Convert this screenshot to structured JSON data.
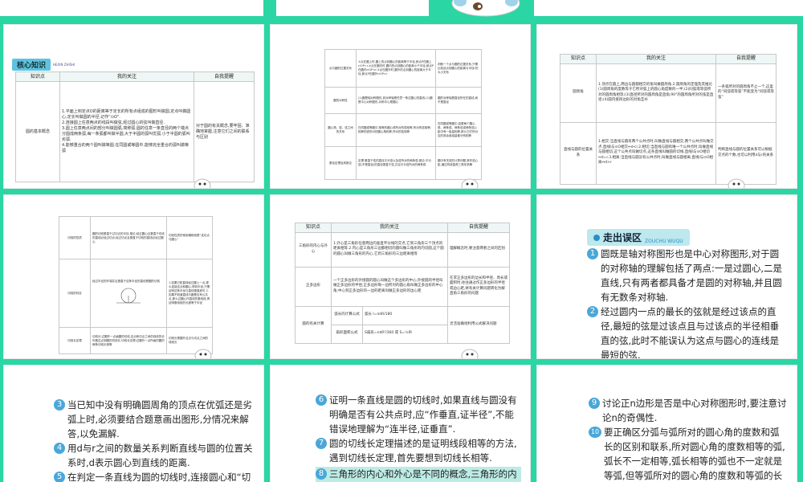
{
  "slide1": {
    "banner_title": "核心知识",
    "banner_sub": "HEXIN ZHISHI",
    "headers": [
      "知识点",
      "我的关注",
      "自我提醒"
    ],
    "row_point": "圆的基本概念",
    "focus_lines": [
      "1.平面上到定点O的距离等于定长的所有点组成的图形叫做圆,定点叫做圆心,定长叫做圆的半径,记作“⊙O”.",
      "2.连接圆上任意两点的线段叫做弦,经过圆心的弦叫做直径.",
      "3.圆上任意两点间的部分叫做圆弧,简称弧.圆的任意一条直径的两个端点分圆成两条弧,每一条弧都叫做半圆,大于半圆的弧叫优弧,小于半圆的弧叫劣弧.",
      "4.能够重合的两个圆叫做等圆.在同圆或等圆中,能够完全重合的弧叫做等弧"
    ],
    "remind": "对于圆的有关概念,要牢固、准确地掌握,注意它们之间的联系与区别"
  },
  "slide2": {
    "rows": [
      {
        "k": "点与圆的位置关系",
        "f": "①点在圆上时,圆上的点到圆心的距离等于半径,即点P在圆上⇔OP=r.②点在圆内时,圆内的点到圆心的距离小于半径,即点P在圆内⇔OP<r.③点在圆外时,圆外的点到圆心的距离大于半径,即点P在圆外⇔OP>r",
        "r": "判断一个点与圆的位置关系,只需比较该点到圆心的距离与半径r的大小关系"
      },
      {
        "k": "圆的对称性",
        "f": "(1)圆是轴对称图形,其对称轴是任意一条过圆心的直线.(2)圆是中心对称图形,对称中心是圆心",
        "r": "圆的对称轴是直径所在的直线,而不是直径"
      },
      {
        "k": "圆心角、弧、弦之间的关系",
        "f": "在同圆或等圆中,相等的圆心角所对的弧相等,所对的弦相等;相等的弧所对的圆心角相等,所对的弦相等",
        "r": "在同圆或等圆中,如果两个圆心角、两条弧、两条弦或两条弦心距中有一组量相等,那么它们所对应的其余各组量都分别相等"
      },
      {
        "k": "垂径定理及其推论",
        "f": "定理:垂直于弦的直径平分弦以及弦所对的两条弧.推论:平分弦(不是直径)的直径垂直于弦,并且平分弦所对的两条弧",
        "r": "圆中有关弦的计算问题,常作弦心距,通过构造直角三角形求解"
      }
    ]
  },
  "slide3": {
    "headers": [
      "知识点",
      "我的关注",
      "自我提醒"
    ],
    "row1_point": "圆周角",
    "row1_focus": "1.顶点在圆上,两边与圆都相交的角叫做圆周角.2.圆周角的定理及其推论(1)圆周角的度数等于它所对弧上的圆心角度数的一半;(2)同弧或等弧所对的圆周角相等;(3)直径所对的圆周角是直角;90°的圆周角所对的弦是直径;(4)圆内接四边形的对角互补",
    "row1_remind": "一条弧所对的圆周角不止一个,这里的“同弧或等弧”不能变为“同弦或等弦”",
    "row2_point": "直线与圆的位置关系",
    "row2_focus": "1.相交:当直线与圆有两个公共点时,叫做直线与圆相交,两个公共点叫做交点.直线l与⊙O相交⇔d<r.2.相切:当直线与圆有唯一个公共点时,叫做直线与圆相切,这个公共点叫做切点,这条直线叫做圆的切线.直线l与⊙O相切⇔d=r.3.相离:当直线与圆没有公共点时,叫做直线与圆相离.直线l与⊙O相离⇔d>r",
    "row2_remind": "判断直线与圆的位置关系可以根据交点的个数,也可以利用d与r的关系"
  },
  "slide4": {
    "rows": [
      {
        "k": "切线的性质",
        "f": "圆的切线垂直于过切点的半径.推论:经过圆心且垂直于切线的直线必经过切点;经过切点且垂直于切线的直线必经过圆心",
        "r": "切线性质的常用辅助线是“连切点与圆心”"
      },
      {
        "k": "切线的判定",
        "f": "经过半径的外端并且垂直于这条半径的直线是圆的切线",
        "r": "1.如果已知直线经过圆上一点,那么连接这点和圆心,得到半径,只需证明这条半径与直线垂直即可.2.如果不知道直线与圆是否有公共点,那么过圆心作直线的垂线段,再证明垂线段的长度等于半径"
      },
      {
        "k": "切线长定理",
        "f": "切线长:过圆外一点画圆的切线,这点和切点之间的线段的长叫做这点到圆的切线长.切线长定理:过圆外一点所画的圆的两条切线长相等",
        "r": "切线长是圆外这点与切点之间的线段长"
      }
    ]
  },
  "slide5": {
    "headers": [
      "知识点",
      "我的关注",
      "自我提醒"
    ],
    "rows": [
      {
        "k": "三角形的内心与外心",
        "f": "1.外心是三角形任意两边的垂直平分线的交点,它到三角形三个顶点的距离相等.2.内心是三角形三边都相切的圆叫做三角形的内切圆,这个圆的圆心叫做三角形的内心,它到三角形的三边距离相等",
        "r": "理解概念时,要注意两者之间的区别"
      },
      {
        "k": "正多边形",
        "f": "一个正多边形的外接圆的圆心叫做这个多边形的中心;外接圆的半径叫做正多边形的半径;正多边形每一边所对的圆心角叫做正多边形的中心角;中心到正多边形的一边的距离叫做正多边形的边心距",
        "r": "在求正多边形的边长和半径、周长或面积时,往往通过作正多边形的半径或边心距,将有关计算问题转化为解直角三角形的问题"
      },
      {
        "k": "圆的有关计算",
        "sub1": "弧长的计算公式",
        "f1": "弧长 l=nπR/180",
        "sub2": "扇形面积公式",
        "f2": "S扇形=nπR²/360 或 S=½lR",
        "r": "灵活准确地利用公式解决问题"
      }
    ]
  },
  "slide6": {
    "title": "走出误区",
    "title_sub": "ZOUCHU WUQU",
    "items": [
      {
        "n": "1",
        "text": "圆既是轴对称图形也是中心对称图形,对于圆的对称轴的理解包括了两点:一是过圆心,二是直线,只有两者都具备才是圆的对称轴,并且圆有无数条对称轴."
      },
      {
        "n": "2",
        "text": "经过圆内一点的最长的弦就是经过该点的直径,最短的弦是过该点且与过该点的半径相垂直的弦,此时不能误认为这点与圆心的连线是最短的弦."
      }
    ]
  },
  "slide7": {
    "items": [
      {
        "n": "3",
        "text": "当已知中没有明确圆周角的顶点在优弧还是劣弧上时,必须要结合题意画出图形,分情况来解答,以免漏解."
      },
      {
        "n": "4",
        "text": "用d与r之间的数量关系判断直线与圆的位置关系时,d表示圆心到直线的距离."
      },
      {
        "n": "5",
        "text": "在判定一条直线为圆的切线时,连接圆心和“切点”(直线与圆的公共点)的线段(或直线)"
      }
    ]
  },
  "slide8": {
    "items": [
      {
        "n": "6",
        "text": "证明一条直线是圆的切线时,如果直线与圆没有明确是否有公共点时,应“作垂直,证半径”,不能错误地理解为“连半径,证垂直”."
      },
      {
        "n": "7",
        "text": "圆的切线长定理描述的是证明线段相等的方法,遇到切线长定理,首先要想到切线长相等."
      },
      {
        "n": "8",
        "text": "三角形的内心和外心是不同的概念,三角形的内切圆的圆心叫做三角形的内心,三角形的外"
      }
    ]
  },
  "slide9": {
    "items": [
      {
        "n": "9",
        "text": "讨论正n边形是否是中心对称图形时,要注意讨论n的奇偶性."
      },
      {
        "n": "10",
        "text": "要正确区分弧与弧所对的圆心角的度数和弧长的区别和联系,所对圆心角的度数相等的弧,弧长不一定相等,弧长相等的弧也不一定就是等弧,但等弧所对的圆心角的度数和等弧的长度一定相等."
      }
    ]
  }
}
